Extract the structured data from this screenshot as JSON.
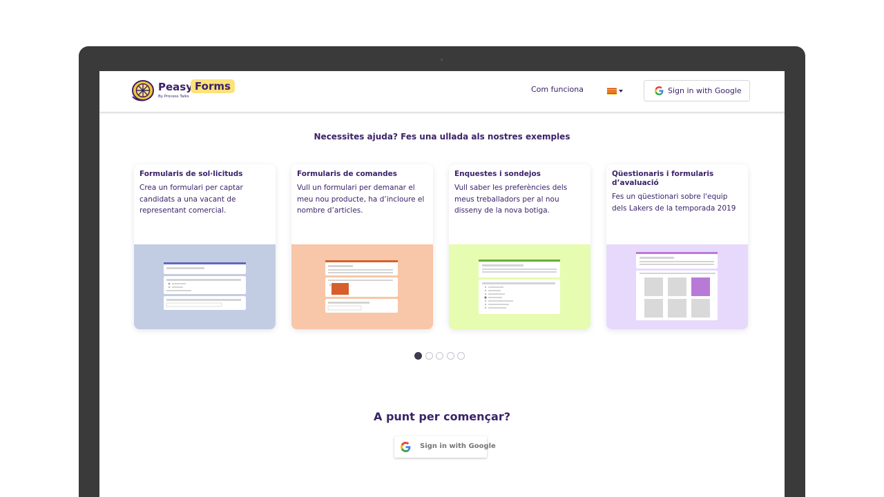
{
  "brand": {
    "name_part1": "Peasy",
    "name_part2": "Forms",
    "tagline": "By Process Talks"
  },
  "nav": {
    "how_it_works": "Com funciona",
    "language": "Català",
    "sign_in": "Sign in with Google"
  },
  "examples": {
    "title": "Necessites ajuda? Fes una ullada als nostres exemples",
    "cards": [
      {
        "title": "Formularis de sol·licituds",
        "description": "Crea un formulari per captar candidats a una vacant de representant comercial.",
        "image_bg": "#c2cde3",
        "accent": "#5f68bd"
      },
      {
        "title": "Formularis de comandes",
        "description": "Vull un formulari per demanar el meu nou producte, ha d’incloure el nombre d’articles.",
        "image_bg": "#f8c6a8",
        "accent": "#d65f2c"
      },
      {
        "title": "Enquestes i sondejos",
        "description": "Vull saber les preferències dels meus treballadors per al nou disseny de la nova botiga.",
        "image_bg": "#e6fcb0",
        "accent": "#6aaa3b"
      },
      {
        "title": "Qüestionaris i formularis d’avaluació",
        "description": "Fes un qüestionari sobre l'equip dels Lakers de la temporada 2019",
        "image_bg": "#e7d9fb",
        "accent": "#b97ad7"
      }
    ],
    "carousel": {
      "pages": 5,
      "active": 0
    }
  },
  "cta": {
    "title": "A punt per començar?",
    "sign_in": "Sign in with Google"
  },
  "colors": {
    "primary_text": "#3b2169",
    "logo_badge": "#fbe27a",
    "laptop_frame": "#3a3a3a"
  }
}
